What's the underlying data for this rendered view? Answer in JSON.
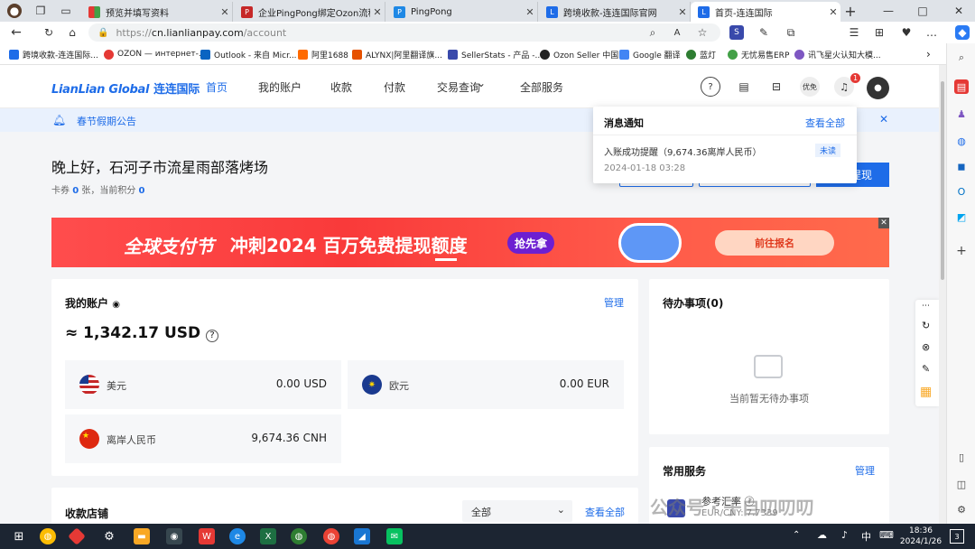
{
  "tabs": [
    {
      "label": "预览并填写资料",
      "fav": "multicolor"
    },
    {
      "label": "企业PingPong绑定Ozon流程指引",
      "fav": "pdf"
    },
    {
      "label": "PingPong",
      "fav": "pp"
    },
    {
      "label": "跨境收款-连连国际官网",
      "fav": "ll"
    },
    {
      "label": "首页-连连国际",
      "fav": "ll"
    }
  ],
  "address": {
    "scheme": "https://",
    "host": "cn.lianlianpay.com",
    "path": "/account"
  },
  "bookmarks": [
    "跨境收款-连连国际...",
    "OZON — интернет-...",
    "Outlook - 来自 Micr...",
    "阿里1688",
    "ALYNX|阿里翻译旗...",
    "SellerStats - 产品 -...",
    "Ozon Seller 中国",
    "Google 翻译",
    "蓝灯",
    "无忧易售ERP",
    "讯飞星火认知大模..."
  ],
  "site": {
    "logo_en": "LianLian Global",
    "logo_cn": "连连国际",
    "nav": [
      "首页",
      "我的账户",
      "收款",
      "付款",
      "交易查询",
      "全部服务"
    ],
    "nav_dropdown_caret": "⌄",
    "header_icons": [
      "help-icon",
      "card-icon",
      "gift-icon",
      "coupon-icon",
      "bell-icon",
      "avatar-icon"
    ],
    "coupon_label": "优免",
    "bell_badge": "1"
  },
  "notice": {
    "text": "春节假期公告"
  },
  "greeting": {
    "title": "晚上好，石河子市流星雨部落烤场",
    "coupons_label": "卡券",
    "coupons_value": "0",
    "coupons_unit": "张，当前积分",
    "points_value": "0",
    "withdraw_label": "提现"
  },
  "banner": {
    "part1": "全球支付节",
    "part2": "冲刺2024 百万免费提现额度",
    "badge": "抢先拿",
    "cta": "前往报名"
  },
  "account": {
    "title": "我的账户",
    "manage": "管理",
    "total_prefix": "≈",
    "total": "1,342.17 USD",
    "currencies": [
      {
        "name": "美元",
        "amount": "0.00 USD",
        "flag": "us"
      },
      {
        "name": "欧元",
        "amount": "0.00 EUR",
        "flag": "eu"
      },
      {
        "name": "离岸人民币",
        "amount": "9,674.36 CNH",
        "flag": "cn"
      }
    ]
  },
  "todo": {
    "title": "待办事项(0)",
    "empty": "当前暂无待办事项"
  },
  "services": {
    "title": "常用服务",
    "manage": "管理",
    "rate_label": "参考汇率",
    "rate_pair": "EUR/CNY: 7.7339"
  },
  "stores": {
    "title": "收款店铺",
    "filter": "全部",
    "view_all": "查看全部"
  },
  "notification": {
    "title": "消息通知",
    "view_all": "查看全部",
    "item": "入账成功提醒（9,674.36离岸人民币）",
    "status": "未读",
    "time": "2024-01-18 03:28"
  },
  "watermark": "公众号 · 子自叨叨叨",
  "taskbar": {
    "time": "18:36",
    "date": "2024/1/26",
    "lang": "中",
    "notif_count": "3"
  },
  "colors": {
    "brand": "#1e6ce8",
    "banner_red": "#f93a3a"
  }
}
